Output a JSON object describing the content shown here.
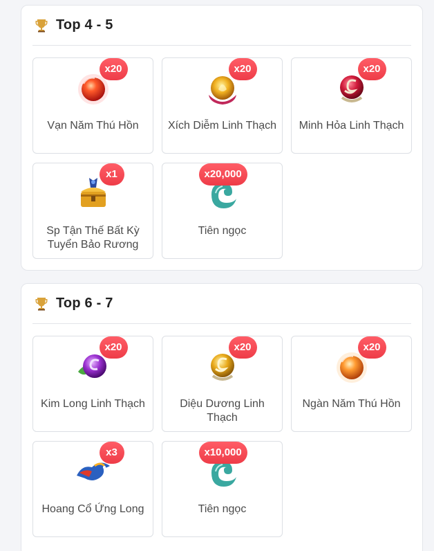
{
  "sections": [
    {
      "title": "Top 4 - 5",
      "items": [
        {
          "name": "Vạn Năm Thú Hồn",
          "qty": "x20",
          "icon": "red-soul-orb-icon"
        },
        {
          "name": "Xích Diễm Linh Thạch",
          "qty": "x20",
          "icon": "flame-spirit-stone-icon"
        },
        {
          "name": "Minh Hỏa Linh Thạch",
          "qty": "x20",
          "icon": "red-dragon-stone-icon"
        },
        {
          "name": "Sp Tận Thế Bất Kỳ Tuyển Bảo Rương",
          "qty": "x1",
          "icon": "treasure-chest-icon"
        },
        {
          "name": "Tiên ngọc",
          "qty": "x20,000",
          "icon": "jade-icon"
        }
      ]
    },
    {
      "title": "Top 6 - 7",
      "items": [
        {
          "name": "Kim Long Linh Thạch",
          "qty": "x20",
          "icon": "purple-dragon-stone-icon"
        },
        {
          "name": "Diệu Dương Linh Thạch",
          "qty": "x20",
          "icon": "gold-dragon-stone-icon"
        },
        {
          "name": "Ngàn Năm Thú Hồn",
          "qty": "x20",
          "icon": "orange-soul-orb-icon"
        },
        {
          "name": "Hoang Cổ Ứng Long",
          "qty": "x3",
          "icon": "dragon-mount-icon"
        },
        {
          "name": "Tiên ngọc",
          "qty": "x10,000",
          "icon": "jade-icon"
        }
      ]
    }
  ],
  "colors": {
    "badge": "#f0444f",
    "trophy": "#d9a23a",
    "card_border": "#dcdfe4",
    "page_bg": "#f4f5f8"
  }
}
